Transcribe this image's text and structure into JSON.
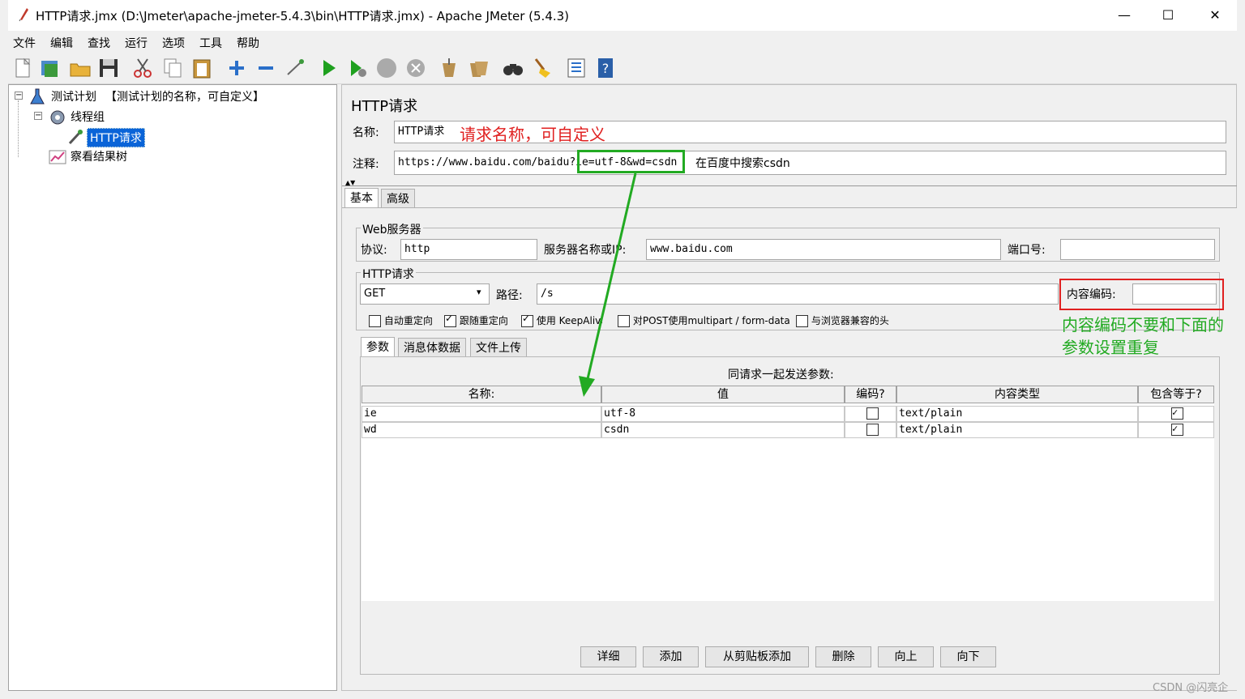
{
  "window": {
    "title": "HTTP请求.jmx (D:\\Jmeter\\apache-jmeter-5.4.3\\bin\\HTTP请求.jmx) - Apache JMeter (5.4.3)",
    "minimize": "—",
    "maximize": "☐",
    "close": "✕"
  },
  "menu": [
    "文件",
    "编辑",
    "查找",
    "运行",
    "选项",
    "工具",
    "帮助"
  ],
  "tree": {
    "test_plan": "测试计划",
    "test_plan_note": "【测试计划的名称，可自定义】",
    "thread_group": "线程组",
    "http_request": "HTTP请求",
    "result_tree": "察看结果树"
  },
  "panel": {
    "title": "HTTP请求",
    "name_label": "名称:",
    "name_value": "HTTP请求",
    "name_annotation": "请求名称，可自定义",
    "comment_label": "注释:",
    "comment_value": "https://www.baidu.com/baidu?ie=utf-8&wd=csdn",
    "comment_suffix": "在百度中搜索csdn",
    "tabs": [
      "基本",
      "高级"
    ],
    "web_server": {
      "legend": "Web服务器",
      "protocol_label": "协议:",
      "protocol_value": "http",
      "server_label": "服务器名称或IP:",
      "server_value": "www.baidu.com",
      "port_label": "端口号:",
      "port_value": ""
    },
    "http_request": {
      "legend": "HTTP请求",
      "method": "GET",
      "path_label": "路径:",
      "path_value": "/s",
      "encoding_label": "内容编码:",
      "encoding_value": ""
    },
    "checkboxes": [
      {
        "label": "自动重定向",
        "checked": false
      },
      {
        "label": "跟随重定向",
        "checked": true
      },
      {
        "label": "使用 KeepAlive",
        "checked": true
      },
      {
        "label": "对POST使用multipart / form-data",
        "checked": false
      },
      {
        "label": "与浏览器兼容的头",
        "checked": false
      }
    ],
    "subtabs": [
      "参数",
      "消息体数据",
      "文件上传"
    ],
    "params_title": "同请求一起发送参数:",
    "columns": [
      "名称:",
      "值",
      "编码?",
      "内容类型",
      "包含等于?"
    ],
    "rows": [
      {
        "name": "ie",
        "value": "utf-8",
        "encode": false,
        "content_type": "text/plain",
        "include_equals": true
      },
      {
        "name": "wd",
        "value": "csdn",
        "encode": false,
        "content_type": "text/plain",
        "include_equals": true
      }
    ],
    "buttons": [
      "详细",
      "添加",
      "从剪贴板添加",
      "删除",
      "向上",
      "向下"
    ],
    "encoding_annotation_line1": "内容编码不要和下面的",
    "encoding_annotation_line2": "参数设置重复"
  },
  "watermark": "CSDN @闪亮企",
  "colors": {
    "annotation_red": "#e02020",
    "annotation_green": "#22aa22",
    "selection": "#0a64d8"
  }
}
